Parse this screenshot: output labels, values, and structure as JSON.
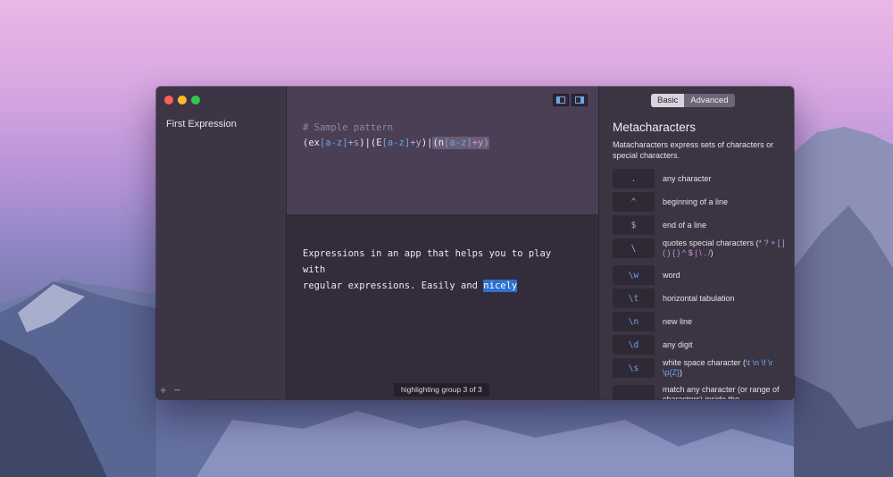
{
  "window": {
    "sidebar": {
      "expressions": [
        "First Expression"
      ],
      "add_label": "+",
      "remove_label": "−"
    },
    "pattern": {
      "comment": "# Sample pattern",
      "parts": {
        "p1": "(",
        "p2": "ex",
        "p3": "[a-z]",
        "p4": "+s",
        "p5": ")|(",
        "p6": "E",
        "p7": "[a-z]",
        "p8": "+y",
        "p9": ")|",
        "p10": "(n",
        "p11": "[a-z]",
        "p12": "+y)"
      }
    },
    "test_text": {
      "line1": "Expressions in an app that helps you to play with",
      "line2_before": "regular expressions. Easily and ",
      "match": "nicely"
    },
    "status": "highlighting group 3 of 3",
    "reference": {
      "tabs": [
        "Basic",
        "Advanced"
      ],
      "active_tab": "Basic",
      "title": "Metacharacters",
      "description": "Matacharacters express sets of characters or special characters.",
      "items": [
        {
          "token": ".",
          "label": "any character"
        },
        {
          "token": "^",
          "label": "beginning of a line"
        },
        {
          "token": "$",
          "label": "end of a line"
        },
        {
          "token": "\\",
          "label": "quotes special characters (",
          "code": "* ? + [ ] ( ) { } ^ $ | \\ . /",
          "label_end": ")"
        },
        {
          "token": "\\w",
          "label": "word"
        },
        {
          "token": "\\t",
          "label": "horizontal tabulation"
        },
        {
          "token": "\\n",
          "label": "new line"
        },
        {
          "token": "\\d",
          "label": "any digit"
        },
        {
          "token": "\\s",
          "label": "white space character (",
          "code": "\\t \\n \\f \\r \\p{Z}",
          "label_end": ")"
        },
        {
          "token": "",
          "label": "match any character (or range of characters) inside the"
        }
      ]
    },
    "colors": {
      "accent_blue": "#6ea3e6",
      "meta_purple": "#c69ad8",
      "selection": "#2e6fd0"
    }
  }
}
